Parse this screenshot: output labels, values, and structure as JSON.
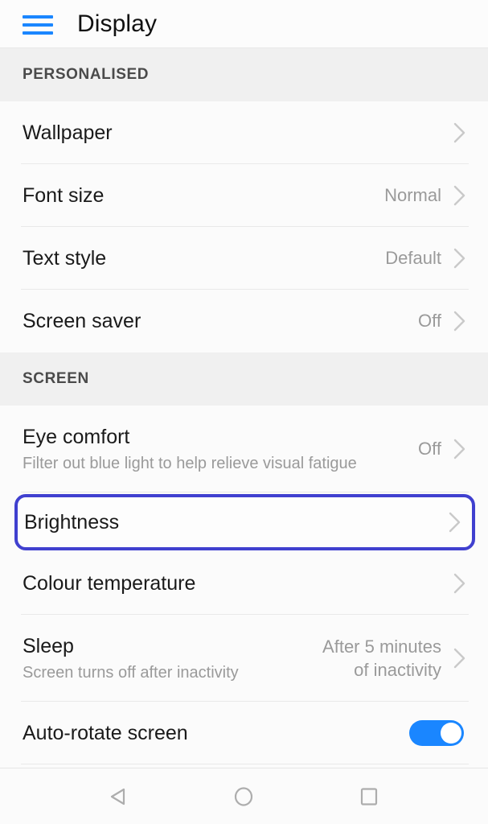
{
  "appbar": {
    "menu_icon": "hamburger-menu-icon",
    "title": "Display",
    "menu_color": "#1a86ff"
  },
  "colors": {
    "accent_blue": "#1a86ff",
    "highlight_border": "#4040cf",
    "section_bg": "#f0f0f0",
    "list_bg": "#fbfbfb",
    "value_text": "#9a9a9a",
    "title_text": "#1a1a1a"
  },
  "sections": [
    {
      "header": "PERSONALISED",
      "rows": [
        {
          "title": "Wallpaper",
          "sub": "",
          "value": "",
          "control": "chevron"
        },
        {
          "title": "Font size",
          "sub": "",
          "value": "Normal",
          "control": "chevron"
        },
        {
          "title": "Text style",
          "sub": "",
          "value": "Default",
          "control": "chevron"
        },
        {
          "title": "Screen saver",
          "sub": "",
          "value": "Off",
          "control": "chevron"
        }
      ]
    },
    {
      "header": "SCREEN",
      "rows": [
        {
          "title": "Eye comfort",
          "sub": "Filter out blue light to help relieve visual fatigue",
          "value": "Off",
          "control": "chevron"
        },
        {
          "title": "Brightness",
          "sub": "",
          "value": "",
          "control": "chevron",
          "highlighted": true
        },
        {
          "title": "Colour temperature",
          "sub": "",
          "value": "",
          "control": "chevron"
        },
        {
          "title": "Sleep",
          "sub": "Screen turns off after inactivity",
          "value": "After 5 minutes\nof inactivity",
          "control": "chevron"
        },
        {
          "title": "Auto-rotate screen",
          "sub": "",
          "value": "",
          "control": "toggle",
          "toggle_on": true
        }
      ]
    }
  ],
  "navbar": {
    "back": "back-triangle-icon",
    "home": "home-circle-icon",
    "recents": "recents-square-icon"
  }
}
